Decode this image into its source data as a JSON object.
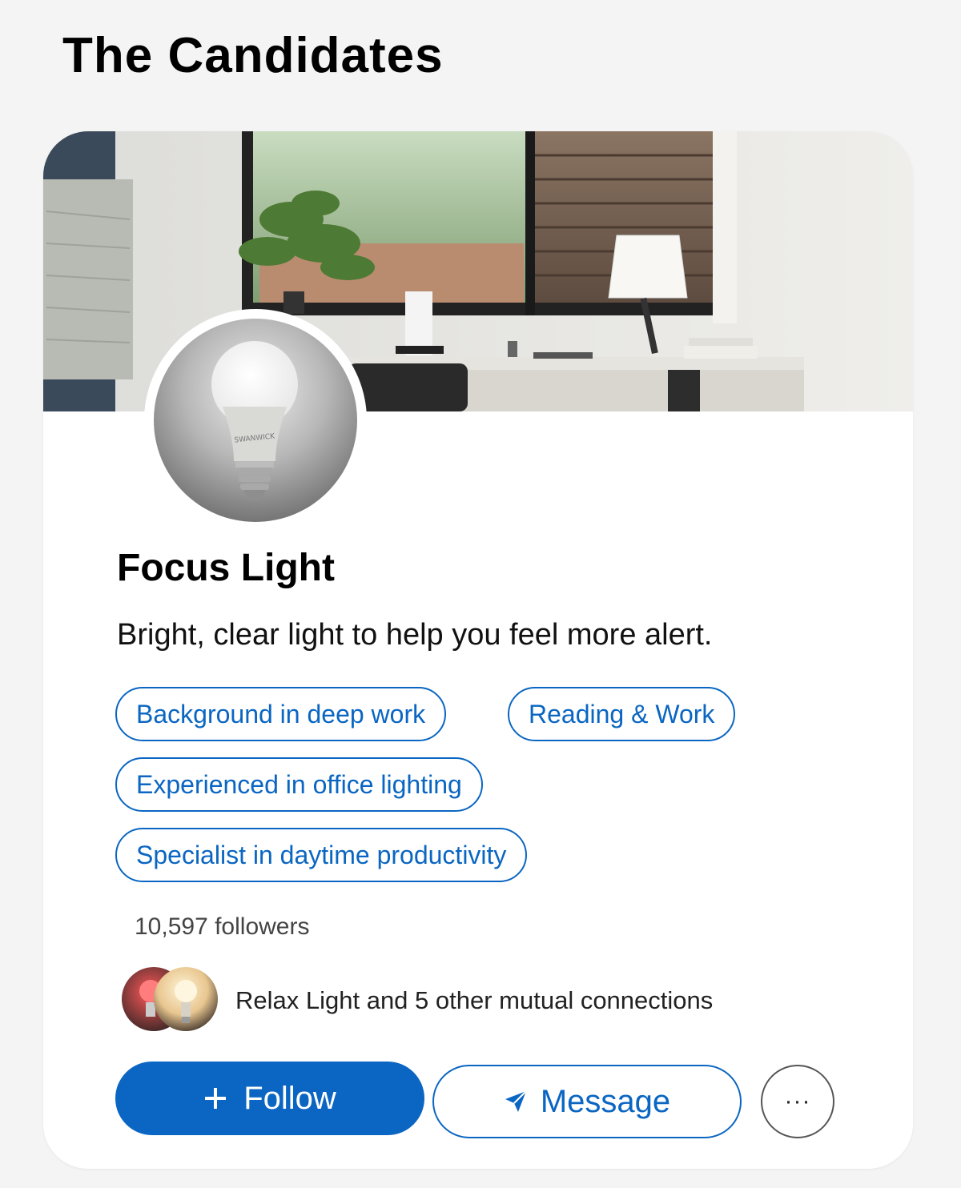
{
  "page": {
    "title": "The Candidates"
  },
  "profile": {
    "name": "Focus Light",
    "tagline": "Bright, clear light to help you feel more alert.",
    "tags": [
      "Background in deep work",
      "Reading & Work",
      "Experienced in office lighting",
      "Specialist in daytime productivity"
    ],
    "followers": "10,597 followers",
    "mutual": "Relax Light and 5 other mutual connections",
    "bulb_brand": "SWANWICK"
  },
  "actions": {
    "follow_label": "Follow",
    "follow_icon": "plus-icon",
    "message_label": "Message",
    "message_icon": "send-icon",
    "more_label": "···",
    "more_icon": "ellipsis-icon"
  },
  "colors": {
    "accent": "#0a66c2",
    "background": "#f4f4f4",
    "card": "#ffffff"
  }
}
